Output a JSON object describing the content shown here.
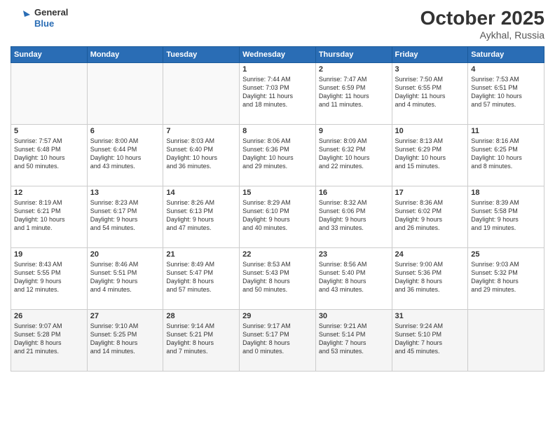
{
  "header": {
    "logo_general": "General",
    "logo_blue": "Blue",
    "month": "October 2025",
    "location": "Aykhal, Russia"
  },
  "weekdays": [
    "Sunday",
    "Monday",
    "Tuesday",
    "Wednesday",
    "Thursday",
    "Friday",
    "Saturday"
  ],
  "weeks": [
    [
      {
        "day": "",
        "info": ""
      },
      {
        "day": "",
        "info": ""
      },
      {
        "day": "",
        "info": ""
      },
      {
        "day": "1",
        "info": "Sunrise: 7:44 AM\nSunset: 7:03 PM\nDaylight: 11 hours\nand 18 minutes."
      },
      {
        "day": "2",
        "info": "Sunrise: 7:47 AM\nSunset: 6:59 PM\nDaylight: 11 hours\nand 11 minutes."
      },
      {
        "day": "3",
        "info": "Sunrise: 7:50 AM\nSunset: 6:55 PM\nDaylight: 11 hours\nand 4 minutes."
      },
      {
        "day": "4",
        "info": "Sunrise: 7:53 AM\nSunset: 6:51 PM\nDaylight: 10 hours\nand 57 minutes."
      }
    ],
    [
      {
        "day": "5",
        "info": "Sunrise: 7:57 AM\nSunset: 6:48 PM\nDaylight: 10 hours\nand 50 minutes."
      },
      {
        "day": "6",
        "info": "Sunrise: 8:00 AM\nSunset: 6:44 PM\nDaylight: 10 hours\nand 43 minutes."
      },
      {
        "day": "7",
        "info": "Sunrise: 8:03 AM\nSunset: 6:40 PM\nDaylight: 10 hours\nand 36 minutes."
      },
      {
        "day": "8",
        "info": "Sunrise: 8:06 AM\nSunset: 6:36 PM\nDaylight: 10 hours\nand 29 minutes."
      },
      {
        "day": "9",
        "info": "Sunrise: 8:09 AM\nSunset: 6:32 PM\nDaylight: 10 hours\nand 22 minutes."
      },
      {
        "day": "10",
        "info": "Sunrise: 8:13 AM\nSunset: 6:29 PM\nDaylight: 10 hours\nand 15 minutes."
      },
      {
        "day": "11",
        "info": "Sunrise: 8:16 AM\nSunset: 6:25 PM\nDaylight: 10 hours\nand 8 minutes."
      }
    ],
    [
      {
        "day": "12",
        "info": "Sunrise: 8:19 AM\nSunset: 6:21 PM\nDaylight: 10 hours\nand 1 minute."
      },
      {
        "day": "13",
        "info": "Sunrise: 8:23 AM\nSunset: 6:17 PM\nDaylight: 9 hours\nand 54 minutes."
      },
      {
        "day": "14",
        "info": "Sunrise: 8:26 AM\nSunset: 6:13 PM\nDaylight: 9 hours\nand 47 minutes."
      },
      {
        "day": "15",
        "info": "Sunrise: 8:29 AM\nSunset: 6:10 PM\nDaylight: 9 hours\nand 40 minutes."
      },
      {
        "day": "16",
        "info": "Sunrise: 8:32 AM\nSunset: 6:06 PM\nDaylight: 9 hours\nand 33 minutes."
      },
      {
        "day": "17",
        "info": "Sunrise: 8:36 AM\nSunset: 6:02 PM\nDaylight: 9 hours\nand 26 minutes."
      },
      {
        "day": "18",
        "info": "Sunrise: 8:39 AM\nSunset: 5:58 PM\nDaylight: 9 hours\nand 19 minutes."
      }
    ],
    [
      {
        "day": "19",
        "info": "Sunrise: 8:43 AM\nSunset: 5:55 PM\nDaylight: 9 hours\nand 12 minutes."
      },
      {
        "day": "20",
        "info": "Sunrise: 8:46 AM\nSunset: 5:51 PM\nDaylight: 9 hours\nand 4 minutes."
      },
      {
        "day": "21",
        "info": "Sunrise: 8:49 AM\nSunset: 5:47 PM\nDaylight: 8 hours\nand 57 minutes."
      },
      {
        "day": "22",
        "info": "Sunrise: 8:53 AM\nSunset: 5:43 PM\nDaylight: 8 hours\nand 50 minutes."
      },
      {
        "day": "23",
        "info": "Sunrise: 8:56 AM\nSunset: 5:40 PM\nDaylight: 8 hours\nand 43 minutes."
      },
      {
        "day": "24",
        "info": "Sunrise: 9:00 AM\nSunset: 5:36 PM\nDaylight: 8 hours\nand 36 minutes."
      },
      {
        "day": "25",
        "info": "Sunrise: 9:03 AM\nSunset: 5:32 PM\nDaylight: 8 hours\nand 29 minutes."
      }
    ],
    [
      {
        "day": "26",
        "info": "Sunrise: 9:07 AM\nSunset: 5:28 PM\nDaylight: 8 hours\nand 21 minutes."
      },
      {
        "day": "27",
        "info": "Sunrise: 9:10 AM\nSunset: 5:25 PM\nDaylight: 8 hours\nand 14 minutes."
      },
      {
        "day": "28",
        "info": "Sunrise: 9:14 AM\nSunset: 5:21 PM\nDaylight: 8 hours\nand 7 minutes."
      },
      {
        "day": "29",
        "info": "Sunrise: 9:17 AM\nSunset: 5:17 PM\nDaylight: 8 hours\nand 0 minutes."
      },
      {
        "day": "30",
        "info": "Sunrise: 9:21 AM\nSunset: 5:14 PM\nDaylight: 7 hours\nand 53 minutes."
      },
      {
        "day": "31",
        "info": "Sunrise: 9:24 AM\nSunset: 5:10 PM\nDaylight: 7 hours\nand 45 minutes."
      },
      {
        "day": "",
        "info": ""
      }
    ]
  ]
}
